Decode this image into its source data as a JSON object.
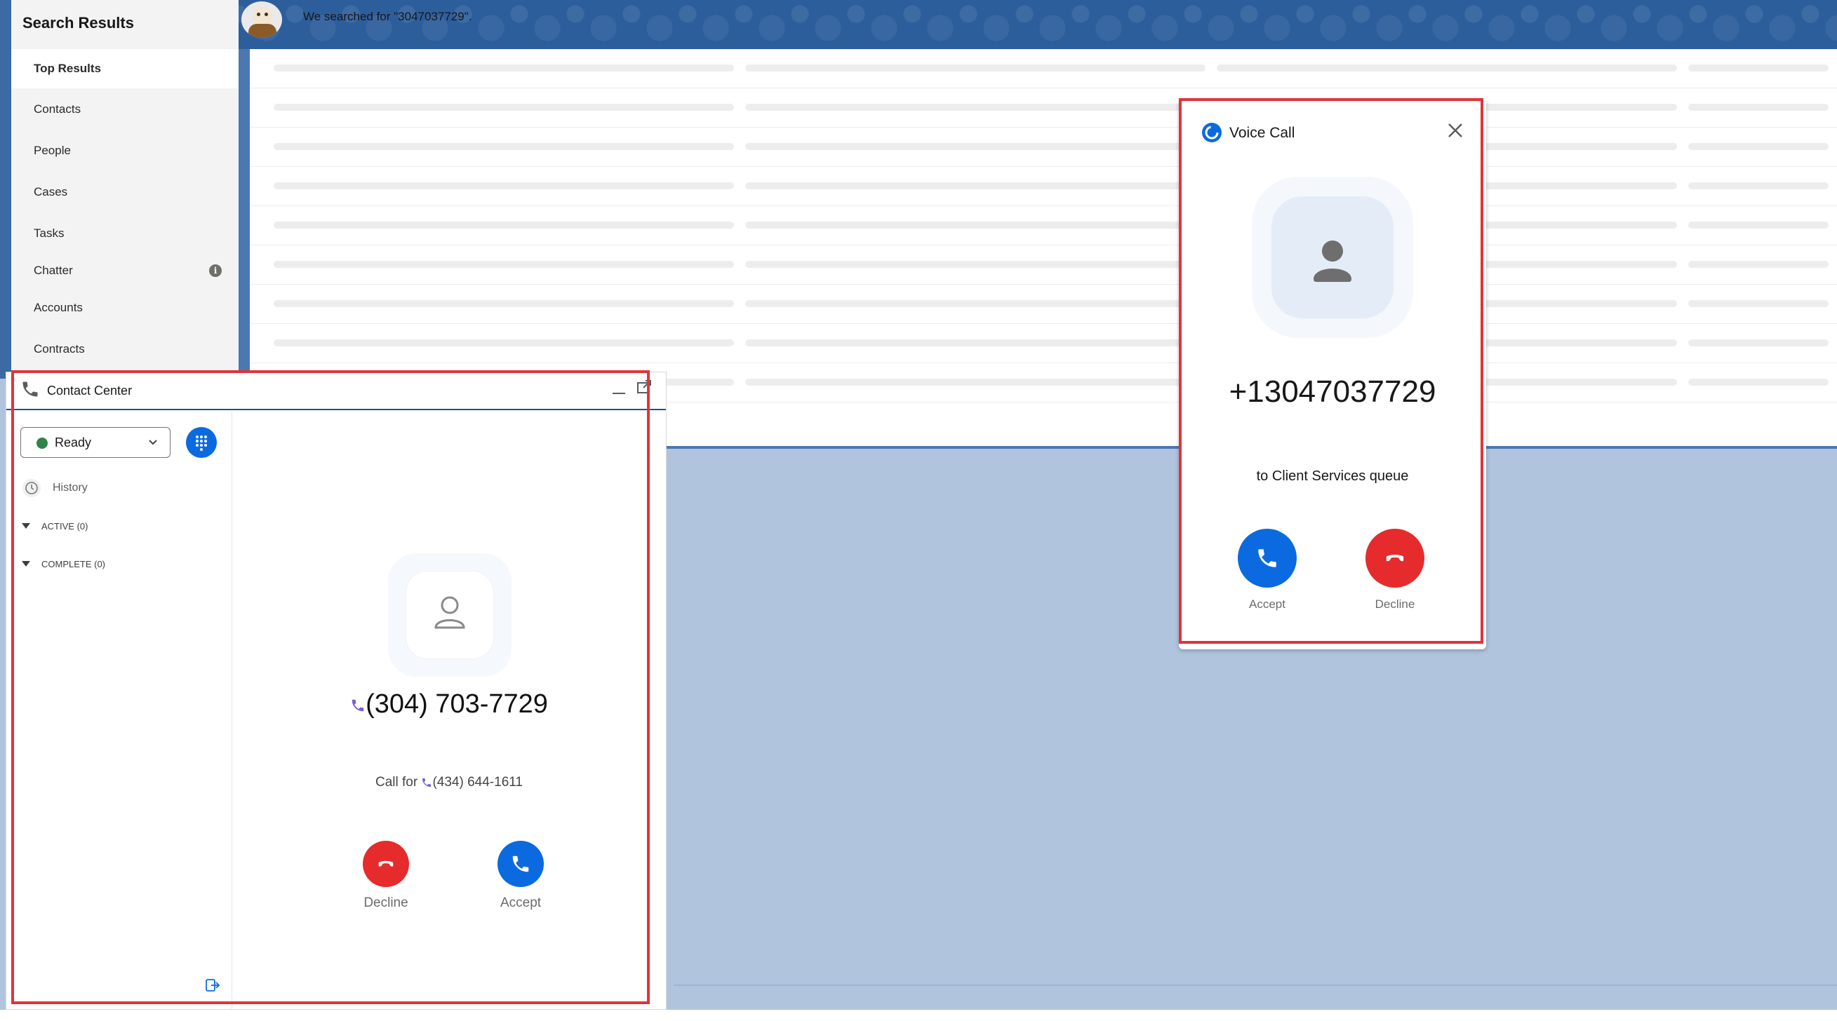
{
  "sidebar": {
    "title": "Search Results",
    "items": [
      {
        "label": "Top Results"
      },
      {
        "label": "Contacts"
      },
      {
        "label": "People"
      },
      {
        "label": "Cases"
      },
      {
        "label": "Tasks"
      },
      {
        "label": "Chatter",
        "badge": "i"
      },
      {
        "label": "Accounts"
      },
      {
        "label": "Contracts"
      }
    ]
  },
  "search": {
    "message": "We searched for \"3047037729\"."
  },
  "contact_center": {
    "title": "Contact Center",
    "status": "Ready",
    "history_label": "History",
    "groups": [
      {
        "label": "ACTIVE (0)"
      },
      {
        "label": "COMPLETE (0)"
      }
    ],
    "caller_number": "(304) 703-7729",
    "call_for_prefix": "Call for",
    "call_for_number": "(434) 644-1611",
    "decline_label": "Decline",
    "accept_label": "Accept"
  },
  "voice_call": {
    "title": "Voice Call",
    "number": "+13047037729",
    "queue_text": "to Client Services queue",
    "accept_label": "Accept",
    "decline_label": "Decline"
  },
  "colors": {
    "accept": "#0b6ae0",
    "decline": "#e52b2b",
    "status_ready": "#2e844a",
    "highlight_box": "#e0343a"
  }
}
